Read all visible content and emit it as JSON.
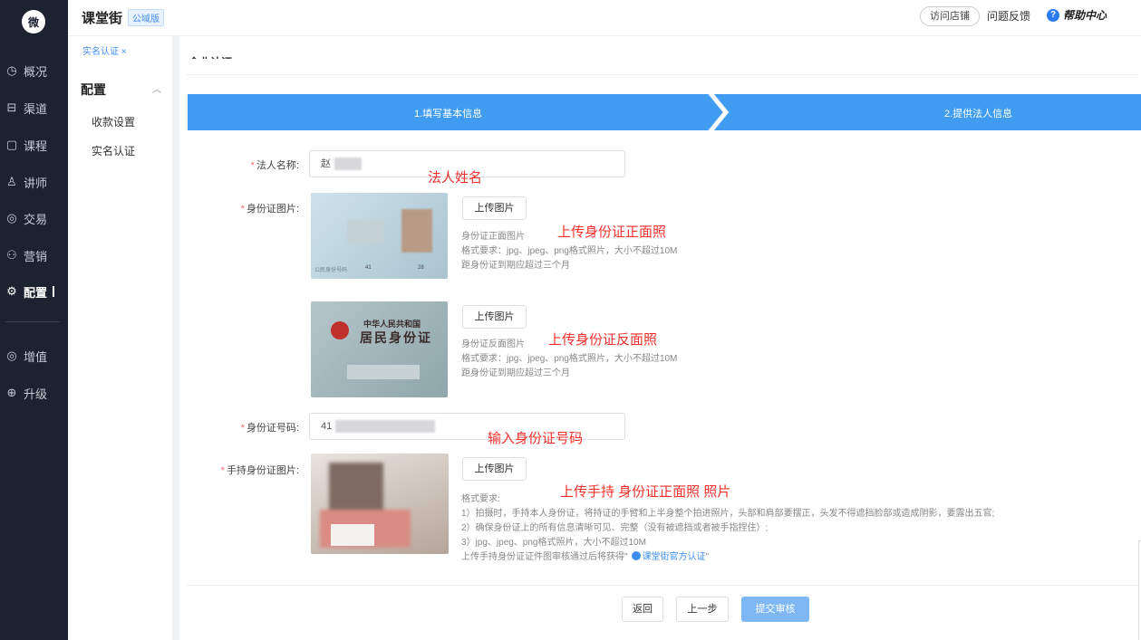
{
  "app": {
    "logo": "微",
    "brand": "课堂街",
    "edition": "公域版"
  },
  "header": {
    "visit_store": "访问店铺",
    "feedback": "问题反馈",
    "help": "帮助中心"
  },
  "nav": [
    {
      "label": "概况",
      "icon": "◷"
    },
    {
      "label": "渠道",
      "icon": "⊟"
    },
    {
      "label": "课程",
      "icon": "▢"
    },
    {
      "label": "讲师",
      "icon": "♙"
    },
    {
      "label": "交易",
      "icon": "◎"
    },
    {
      "label": "营销",
      "icon": "⚇"
    },
    {
      "label": "配置",
      "icon": "⚙"
    },
    {
      "label": "增值",
      "icon": "◎"
    },
    {
      "label": "升级",
      "icon": "⊕"
    }
  ],
  "breadcrumb": "实名认证 ×",
  "sub": {
    "title": "配置",
    "items": [
      "收款设置",
      "实名认证"
    ]
  },
  "section_title": "企业认证",
  "steps": [
    "1.填写基本信息",
    "2.提供法人信息"
  ],
  "form": {
    "legal_name": {
      "label": "法人名称:",
      "value": "赵"
    },
    "id_photo": {
      "label": "身份证图片:"
    },
    "id_number": {
      "label": "身份证号码:",
      "value": "41"
    },
    "hold_photo": {
      "label": "手持身份证图片:"
    },
    "upload": "上传图片",
    "front": {
      "title": "身份证正面图片",
      "format": "格式要求：jpg、jpeg、png格式照片，大小不超过10M",
      "expiry": "距身份证到期应超过三个月",
      "card_serial": "41",
      "card_tail": "28",
      "card_label": "公民身份号码"
    },
    "back": {
      "title": "身份证反面图片",
      "format": "格式要求：jpg、jpeg、png格式照片，大小不超过10M",
      "expiry": "距身份证到期应超过三个月",
      "card_line1": "中华人民共和国",
      "card_line2": "居民身份证"
    },
    "hold": {
      "title": "格式要求:",
      "req1": "1）拍摄时，手持本人身份证，将持证的手臂和上半身整个拍进照片，头部和肩部要摆正，头发不得遮挡脸部或造成阴影，要露出五官;",
      "req2": "2）确保身份证上的所有信息清晰可见、完整（没有被遮挡或者被手指捏住）;",
      "req3": "3）jpg、jpeg、png格式照片，大小不超过10M",
      "cert_prefix": "上传手持身份证证件图审核通过后将获得\"",
      "cert_name": "课堂街官方认证",
      "cert_suffix": "\""
    }
  },
  "annotations": {
    "name": "法人姓名",
    "front": "上传身份证正面照",
    "back": "上传身份证反面照",
    "number": "输入身份证号码",
    "hold": "上传手持 身份证正面照 照片"
  },
  "footer": {
    "back": "返回",
    "prev": "上一步",
    "submit": "提交审核"
  }
}
